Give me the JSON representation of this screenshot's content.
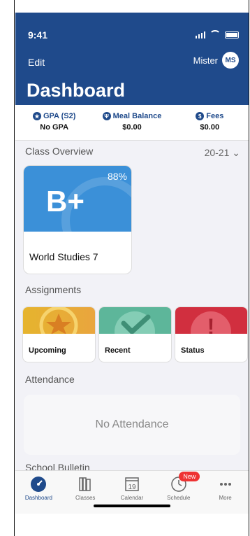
{
  "status_bar": {
    "time": "9:41"
  },
  "header": {
    "edit": "Edit",
    "user_name": "Mister",
    "avatar": "MS",
    "title": "Dashboard",
    "accent": "#1f4a8b"
  },
  "stats": [
    {
      "label": "GPA (S2)",
      "value": "No GPA",
      "icon": "star-icon"
    },
    {
      "label": "Meal Balance",
      "value": "$0.00",
      "icon": "utensils-icon"
    },
    {
      "label": "Fees",
      "value": "$0.00",
      "icon": "dollar-icon"
    }
  ],
  "class_overview": {
    "title": "Class Overview",
    "year": "20-21",
    "grade": "B+",
    "percent": "88%",
    "class_name": "World Studies 7"
  },
  "assignments": {
    "title": "Assignments",
    "cards": [
      "Upcoming",
      "Recent",
      "Status"
    ]
  },
  "attendance": {
    "title": "Attendance",
    "empty": "No Attendance"
  },
  "bulletin": {
    "title": "School Bulletin"
  },
  "tabs": [
    {
      "label": "Dashboard",
      "icon": "dashboard-icon"
    },
    {
      "label": "Classes",
      "icon": "books-icon"
    },
    {
      "label": "Calendar",
      "icon": "calendar-icon",
      "date": "19"
    },
    {
      "label": "Schedule",
      "icon": "clock-icon",
      "badge": "New"
    },
    {
      "label": "More",
      "icon": "more-icon"
    }
  ]
}
